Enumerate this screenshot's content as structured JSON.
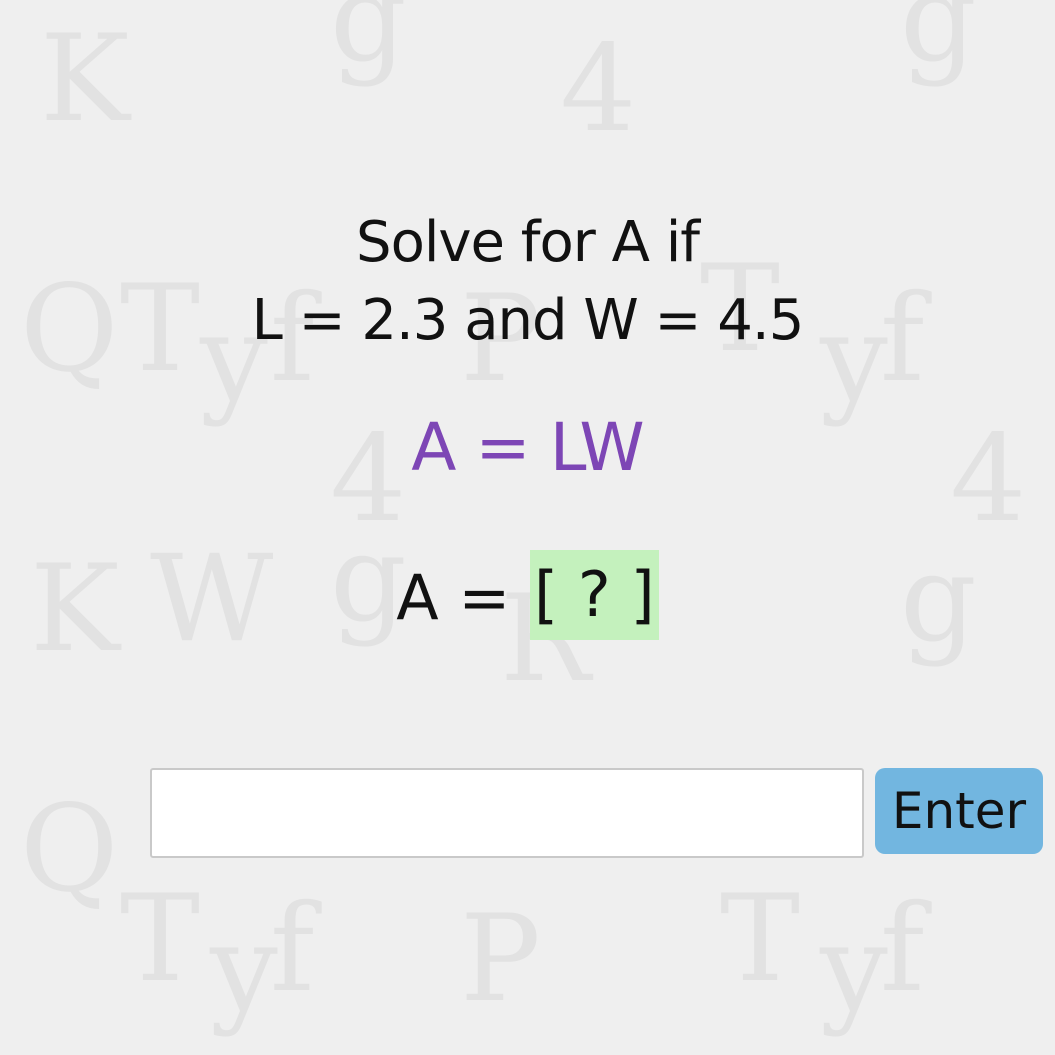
{
  "question": {
    "line1": "Solve for A if",
    "line2": "L = 2.3 and W = 4.5",
    "formula": "A = LW",
    "answer_prefix": "A = ",
    "answer_blank": "[ ? ]"
  },
  "answer_input": {
    "value": "",
    "placeholder": ""
  },
  "enter_button": {
    "label": "Enter"
  },
  "colors": {
    "background": "#efefef",
    "formula": "#7d46b5",
    "blank_highlight": "#c4f1bd",
    "button": "#72b6e0"
  }
}
